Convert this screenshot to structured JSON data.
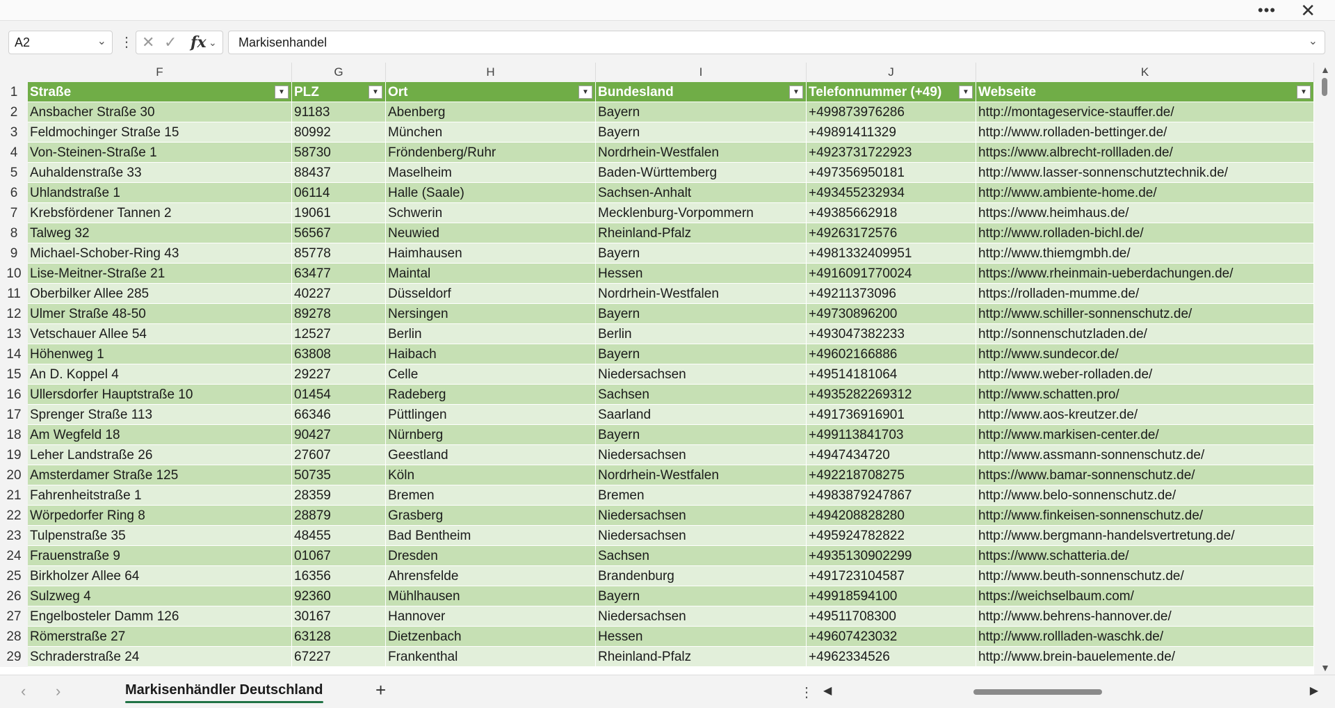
{
  "window": {
    "more_label": "•••",
    "close_label": "✕"
  },
  "formula_bar": {
    "name_box": "A2",
    "formula_value": "Markisenhandel",
    "fx_label": "fx"
  },
  "columns": [
    "F",
    "G",
    "H",
    "I",
    "J",
    "K"
  ],
  "table": {
    "headers": [
      "Straße",
      "PLZ",
      "Ort",
      "Bundesland",
      "Telefonnummer (+49)",
      "Webseite"
    ],
    "rows": [
      [
        "2",
        "Ansbacher Straße 30",
        "91183",
        "Abenberg",
        "Bayern",
        "+499873976286",
        "http://montageservice-stauffer.de/"
      ],
      [
        "3",
        "Feldmochinger Straße 15",
        "80992",
        "München",
        "Bayern",
        "+49891411329",
        "http://www.rolladen-bettinger.de/"
      ],
      [
        "4",
        "Von-Steinen-Straße 1",
        "58730",
        "Fröndenberg/Ruhr",
        "Nordrhein-Westfalen",
        "+4923731722923",
        "https://www.albrecht-rollladen.de/"
      ],
      [
        "5",
        "Auhaldenstraße 33",
        "88437",
        "Maselheim",
        "Baden-Württemberg",
        "+497356950181",
        "http://www.lasser-sonnenschutztechnik.de/"
      ],
      [
        "6",
        "Uhlandstraße 1",
        "06114",
        "Halle (Saale)",
        "Sachsen-Anhalt",
        "+493455232934",
        "http://www.ambiente-home.de/"
      ],
      [
        "7",
        "Krebsfördener Tannen 2",
        "19061",
        "Schwerin",
        "Mecklenburg-Vorpommern",
        "+49385662918",
        "https://www.heimhaus.de/"
      ],
      [
        "8",
        "Talweg 32",
        "56567",
        "Neuwied",
        "Rheinland-Pfalz",
        "+49263172576",
        "http://www.rolladen-bichl.de/"
      ],
      [
        "9",
        "Michael-Schober-Ring 43",
        "85778",
        "Haimhausen",
        "Bayern",
        "+4981332409951",
        "http://www.thiemgmbh.de/"
      ],
      [
        "10",
        "Lise-Meitner-Straße 21",
        "63477",
        "Maintal",
        "Hessen",
        "+4916091770024",
        "https://www.rheinmain-ueberdachungen.de/"
      ],
      [
        "11",
        "Oberbilker Allee 285",
        "40227",
        "Düsseldorf",
        "Nordrhein-Westfalen",
        "+49211373096",
        "https://rolladen-mumme.de/"
      ],
      [
        "12",
        "Ulmer Straße 48-50",
        "89278",
        "Nersingen",
        "Bayern",
        "+49730896200",
        "http://www.schiller-sonnenschutz.de/"
      ],
      [
        "13",
        "Vetschauer Allee 54",
        "12527",
        "Berlin",
        "Berlin",
        "+493047382233",
        "http://sonnenschutzladen.de/"
      ],
      [
        "14",
        "Höhenweg 1",
        "63808",
        "Haibach",
        "Bayern",
        "+49602166886",
        "http://www.sundecor.de/"
      ],
      [
        "15",
        "An D. Koppel 4",
        "29227",
        "Celle",
        "Niedersachsen",
        "+49514181064",
        "http://www.weber-rolladen.de/"
      ],
      [
        "16",
        "Ullersdorfer Hauptstraße 10",
        "01454",
        "Radeberg",
        "Sachsen",
        "+4935282269312",
        "http://www.schatten.pro/"
      ],
      [
        "17",
        "Sprenger Straße 113",
        "66346",
        "Püttlingen",
        "Saarland",
        "+491736916901",
        "http://www.aos-kreutzer.de/"
      ],
      [
        "18",
        "Am Wegfeld 18",
        "90427",
        "Nürnberg",
        "Bayern",
        "+499113841703",
        "http://www.markisen-center.de/"
      ],
      [
        "19",
        "Leher Landstraße 26",
        "27607",
        "Geestland",
        "Niedersachsen",
        "+4947434720",
        "http://www.assmann-sonnenschutz.de/"
      ],
      [
        "20",
        "Amsterdamer Straße 125",
        "50735",
        "Köln",
        "Nordrhein-Westfalen",
        "+492218708275",
        "https://www.bamar-sonnenschutz.de/"
      ],
      [
        "21",
        "Fahrenheitstraße 1",
        "28359",
        "Bremen",
        "Bremen",
        "+4983879247867",
        "http://www.belo-sonnenschutz.de/"
      ],
      [
        "22",
        "Wörpedorfer Ring 8",
        "28879",
        "Grasberg",
        "Niedersachsen",
        "+494208828280",
        "http://www.finkeisen-sonnenschutz.de/"
      ],
      [
        "23",
        "Tulpenstraße 35",
        "48455",
        "Bad Bentheim",
        "Niedersachsen",
        "+495924782822",
        "http://www.bergmann-handelsvertretung.de/"
      ],
      [
        "24",
        "Frauenstraße 9",
        "01067",
        "Dresden",
        "Sachsen",
        "+4935130902299",
        "https://www.schatteria.de/"
      ],
      [
        "25",
        "Birkholzer Allee 64",
        "16356",
        "Ahrensfelde",
        "Brandenburg",
        "+491723104587",
        "http://www.beuth-sonnenschutz.de/"
      ],
      [
        "26",
        "Sulzweg 4",
        "92360",
        "Mühlhausen",
        "Bayern",
        "+49918594100",
        "https://weichselbaum.com/"
      ],
      [
        "27",
        "Engelbosteler Damm 126",
        "30167",
        "Hannover",
        "Niedersachsen",
        "+49511708300",
        "http://www.behrens-hannover.de/"
      ],
      [
        "28",
        "Römerstraße 27",
        "63128",
        "Dietzenbach",
        "Hessen",
        "+49607423032",
        "http://www.rollladen-waschk.de/"
      ],
      [
        "29",
        "Schraderstraße 24",
        "67227",
        "Frankenthal",
        "Rheinland-Pfalz",
        "+4962334526",
        "http://www.brein-bauelemente.de/"
      ]
    ]
  },
  "sheets": {
    "active_tab": "Markisenhändler Deutschland",
    "add_label": "+"
  },
  "colors": {
    "header_green": "#70ad47",
    "band_dark": "#c6e0b4",
    "band_light": "#e2efda",
    "accent": "#217346"
  }
}
